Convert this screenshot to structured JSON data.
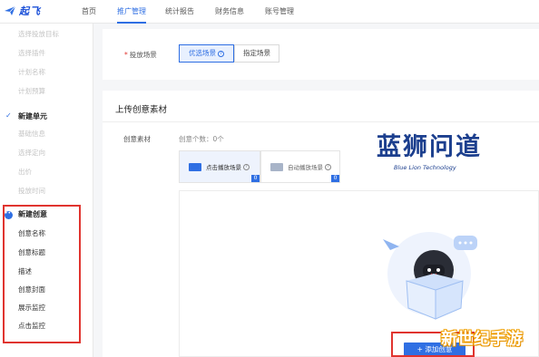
{
  "app": {
    "logo_text": "起飞"
  },
  "nav": [
    {
      "label": "首页"
    },
    {
      "label": "推广管理"
    },
    {
      "label": "统计报告"
    },
    {
      "label": "财务信息"
    },
    {
      "label": "账号管理"
    }
  ],
  "sidebar": {
    "items_top": [
      {
        "label": "选择投放目标"
      },
      {
        "label": "选择插件"
      },
      {
        "label": "计划名称"
      },
      {
        "label": "计划预算"
      }
    ],
    "unit_head": "新建单元",
    "unit_items": [
      {
        "label": "基础信息"
      },
      {
        "label": "选择定向"
      },
      {
        "label": "出价"
      },
      {
        "label": "投放时间"
      }
    ],
    "creative_head": "新建创意",
    "creative_items": [
      {
        "label": "创意名称"
      },
      {
        "label": "创意标题"
      },
      {
        "label": "描述"
      },
      {
        "label": "创意封面"
      },
      {
        "label": "展示监控"
      },
      {
        "label": "点击监控"
      }
    ]
  },
  "placement": {
    "required_mark": "*",
    "label": "投放场景",
    "option_preferred": "优选场景",
    "option_specified": "指定场景"
  },
  "upload": {
    "section_title": "上传创意素材",
    "material_label": "创意素材",
    "count_text": "创意个数：0个",
    "tabs": [
      {
        "label": "点击播放场景",
        "badge": "0"
      },
      {
        "label": "自动播放场景",
        "badge": "0"
      }
    ],
    "add_button": "+ 添加创意"
  },
  "watermark": {
    "cn": "蓝狮问道",
    "en": "Blue Lion Technology",
    "corner": "新世纪手游"
  },
  "colors": {
    "accent": "#2f6fe3",
    "highlight": "#e0342f",
    "brand": "#1c3f8e"
  }
}
